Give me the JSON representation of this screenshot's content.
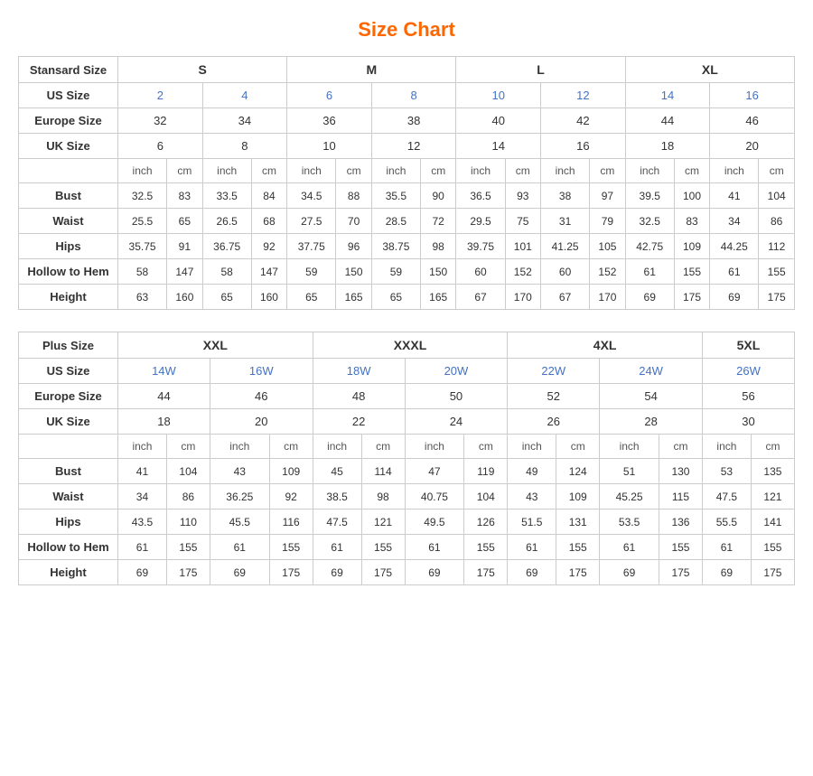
{
  "title": "Size Chart",
  "standard": {
    "section_label": "Stansard Size",
    "size_groups": [
      "S",
      "M",
      "L",
      "XL"
    ],
    "us_sizes": [
      "2",
      "4",
      "6",
      "8",
      "10",
      "12",
      "14",
      "16"
    ],
    "europe_sizes": [
      "32",
      "34",
      "36",
      "38",
      "40",
      "42",
      "44",
      "46"
    ],
    "uk_sizes": [
      "6",
      "8",
      "10",
      "12",
      "14",
      "16",
      "18",
      "20"
    ],
    "units": [
      "inch",
      "cm",
      "inch",
      "cm",
      "inch",
      "cm",
      "inch",
      "cm",
      "inch",
      "cm",
      "inch",
      "cm",
      "inch",
      "cm",
      "inch",
      "cm"
    ],
    "measurements": {
      "bust": [
        "32.5",
        "83",
        "33.5",
        "84",
        "34.5",
        "88",
        "35.5",
        "90",
        "36.5",
        "93",
        "38",
        "97",
        "39.5",
        "100",
        "41",
        "104"
      ],
      "waist": [
        "25.5",
        "65",
        "26.5",
        "68",
        "27.5",
        "70",
        "28.5",
        "72",
        "29.5",
        "75",
        "31",
        "79",
        "32.5",
        "83",
        "34",
        "86"
      ],
      "hips": [
        "35.75",
        "91",
        "36.75",
        "92",
        "37.75",
        "96",
        "38.75",
        "98",
        "39.75",
        "101",
        "41.25",
        "105",
        "42.75",
        "109",
        "44.25",
        "112"
      ],
      "hollow_to_hem": [
        "58",
        "147",
        "58",
        "147",
        "59",
        "150",
        "59",
        "150",
        "60",
        "152",
        "60",
        "152",
        "61",
        "155",
        "61",
        "155"
      ],
      "height": [
        "63",
        "160",
        "65",
        "160",
        "65",
        "165",
        "65",
        "165",
        "67",
        "170",
        "67",
        "170",
        "69",
        "175",
        "69",
        "175"
      ]
    }
  },
  "plus": {
    "section_label": "Plus Size",
    "size_groups": [
      "XXL",
      "XXXL",
      "4XL",
      "5XL"
    ],
    "us_sizes": [
      "14W",
      "16W",
      "18W",
      "20W",
      "22W",
      "24W",
      "26W"
    ],
    "europe_sizes": [
      "44",
      "46",
      "48",
      "50",
      "52",
      "54",
      "56"
    ],
    "uk_sizes": [
      "18",
      "20",
      "22",
      "24",
      "26",
      "28",
      "30"
    ],
    "units": [
      "inch",
      "cm",
      "inch",
      "cm",
      "inch",
      "cm",
      "inch",
      "cm",
      "inch",
      "cm",
      "inch",
      "cm",
      "inch",
      "cm"
    ],
    "measurements": {
      "bust": [
        "41",
        "104",
        "43",
        "109",
        "45",
        "114",
        "47",
        "119",
        "49",
        "124",
        "51",
        "130",
        "53",
        "135"
      ],
      "waist": [
        "34",
        "86",
        "36.25",
        "92",
        "38.5",
        "98",
        "40.75",
        "104",
        "43",
        "109",
        "45.25",
        "115",
        "47.5",
        "121"
      ],
      "hips": [
        "43.5",
        "110",
        "45.5",
        "116",
        "47.5",
        "121",
        "49.5",
        "126",
        "51.5",
        "131",
        "53.5",
        "136",
        "55.5",
        "141"
      ],
      "hollow_to_hem": [
        "61",
        "155",
        "61",
        "155",
        "61",
        "155",
        "61",
        "155",
        "61",
        "155",
        "61",
        "155",
        "61",
        "155"
      ],
      "height": [
        "69",
        "175",
        "69",
        "175",
        "69",
        "175",
        "69",
        "175",
        "69",
        "175",
        "69",
        "175",
        "69",
        "175"
      ]
    }
  },
  "row_labels": {
    "us_size": "US Size",
    "europe_size": "Europe Size",
    "uk_size": "UK Size",
    "bust": "Bust",
    "waist": "Waist",
    "hips": "Hips",
    "hollow_to_hem": "Hollow to Hem",
    "height": "Height"
  }
}
